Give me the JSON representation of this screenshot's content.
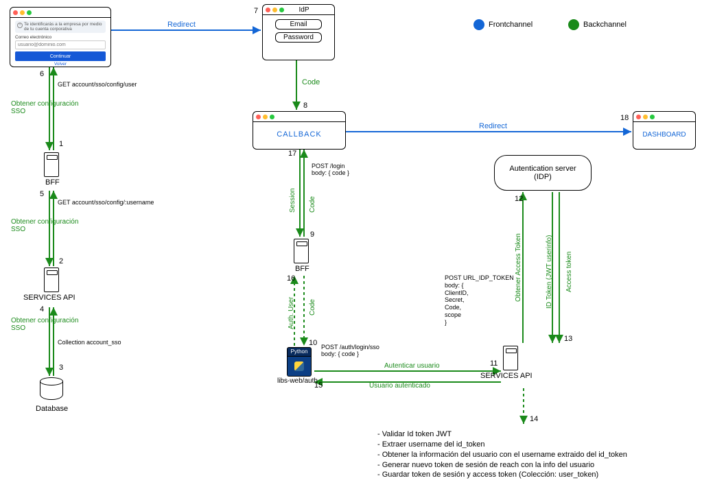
{
  "legend": {
    "front": "Frontchannel",
    "back": "Backchannel"
  },
  "loginWin": {
    "banner": "Te identificarás a la empresa por medio de tu cuenta corporativa",
    "emailLabel": "Correo electrónico",
    "emailPlaceholder": "usuario@dominio.com",
    "continue": "Continuar",
    "volver": "Volver"
  },
  "idp": {
    "title": "IdP",
    "email": "Email",
    "password": "Password"
  },
  "callback": {
    "title": "CALLBACK"
  },
  "dashboard": {
    "title": "DASHBOARD"
  },
  "authServer": {
    "title1": "Autentication server",
    "title2": "(IDP)"
  },
  "nodes": {
    "bff1": "BFF",
    "servicesApi": "SERVICES API",
    "database": "Database",
    "bff2": "BFF",
    "libsWebAuth": "libs-web/auth",
    "servicesApi2": "SERVICES API",
    "pyHeader": "Python"
  },
  "steps": {
    "s1": "1",
    "s2": "2",
    "s3": "3",
    "s4": "4",
    "s5": "5",
    "s6": "6",
    "s7": "7",
    "s8": "8",
    "s9": "9",
    "s10": "10",
    "s11": "11",
    "s12": "12",
    "s13": "13",
    "s14": "14",
    "s15": "15",
    "s16": "16",
    "s17": "17",
    "s18": "18"
  },
  "edges": {
    "redirect1": "Redirect",
    "redirect2": "Redirect",
    "code1": "Code",
    "getConfigUser": "GET account/sso/config/user",
    "obtConfSSO": "Obtener configuración\nSSO",
    "getConfigUsername": "GET account/sso/config/:username",
    "collection": "Collection account_sso",
    "postLogin": "POST /login\nbody: { code }",
    "session": "Session",
    "code2": "Code",
    "authUser": "Auth. User",
    "postAuthLogin": "POST /auth/login/sso\nbody: { code }",
    "autenticar": "Autenticar usuario",
    "usuarioAutenticado": "Usuario autenticado",
    "postIdpToken": "POST URL_IDP_TOKEN\nbody: {\n      ClientID,\n      Secret,\n      Code,\n      scope\n}",
    "obtenerAccess": "Obtener Access Token",
    "idToken": "ID Token (JWT userinfo)",
    "accessToken": "Access token"
  },
  "notes": {
    "l1": "- Validar Id token JWT",
    "l2": "- Extraer username del id_token",
    "l3": "- Obtener la información del usuario con el username extraido del id_token",
    "l4": "- Generar nuevo token de sesión de reach con la info del usuario",
    "l5": "- Guardar token de sesión y access token (Colección: user_token)"
  }
}
